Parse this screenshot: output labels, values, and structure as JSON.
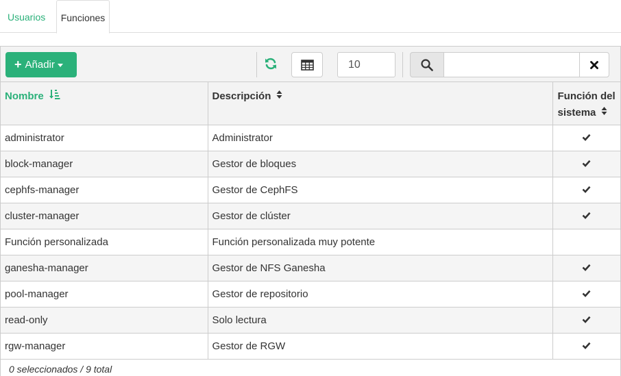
{
  "tabs": [
    {
      "label": "Usuarios",
      "active": false
    },
    {
      "label": "Funciones",
      "active": true
    }
  ],
  "toolbar": {
    "add_label": "Añadir",
    "page_size": "10",
    "search_value": "",
    "icons": {
      "add": "plus-icon",
      "caret": "caret-down-icon",
      "refresh": "refresh-icon",
      "columns": "table-columns-icon",
      "search": "search-icon",
      "clear": "close-icon"
    }
  },
  "table": {
    "columns": [
      {
        "label": "Nombre",
        "sort": "ascending"
      },
      {
        "label": "Descripción",
        "sort": "none"
      },
      {
        "label_line1": "Función del",
        "label_line2": "sistema",
        "sort": "none"
      }
    ],
    "rows": [
      {
        "name": "administrator",
        "description": "Administrator",
        "system": true
      },
      {
        "name": "block-manager",
        "description": "Gestor de bloques",
        "system": true
      },
      {
        "name": "cephfs-manager",
        "description": "Gestor de CephFS",
        "system": true
      },
      {
        "name": "cluster-manager",
        "description": "Gestor de clúster",
        "system": true
      },
      {
        "name": "Función personalizada",
        "description": "Función personalizada muy potente",
        "system": false
      },
      {
        "name": "ganesha-manager",
        "description": "Gestor de NFS Ganesha",
        "system": true
      },
      {
        "name": "pool-manager",
        "description": "Gestor de repositorio",
        "system": true
      },
      {
        "name": "read-only",
        "description": "Solo lectura",
        "system": true
      },
      {
        "name": "rgw-manager",
        "description": "Gestor de RGW",
        "system": true
      }
    ]
  },
  "footer": {
    "summary": "0 seleccionados / 9 total"
  },
  "colors": {
    "accent": "#2bb17a",
    "header_bg": "#f3f3f3",
    "border": "#cccccc"
  }
}
